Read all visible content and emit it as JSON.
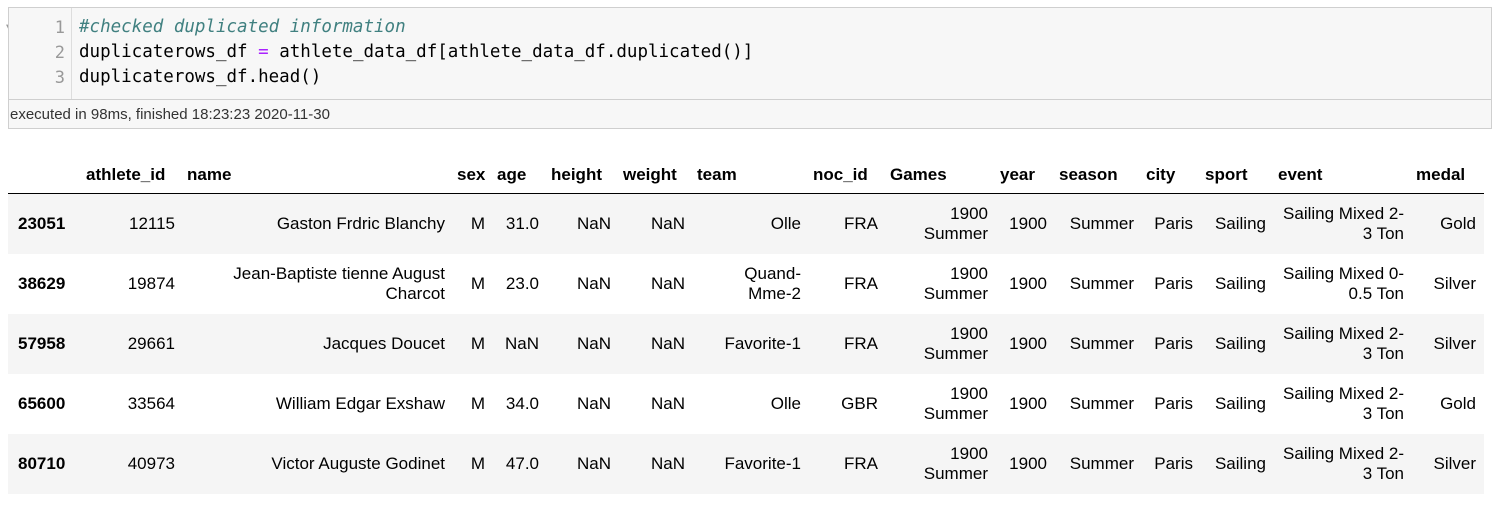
{
  "code_cell": {
    "lines": [
      {
        "number": "1",
        "text": "#checked duplicated information"
      },
      {
        "number": "2",
        "var": "duplicaterows_df",
        "op": "=",
        "expr": "athlete_data_df[athlete_data_df.duplicated()]"
      },
      {
        "number": "3",
        "text": "duplicaterows_df.head()"
      }
    ],
    "status": "executed in 98ms, finished 18:23:23 2020-11-30"
  },
  "table": {
    "columns": [
      "",
      "athlete_id",
      "name",
      "sex",
      "age",
      "height",
      "weight",
      "team",
      "noc_id",
      "Games",
      "year",
      "season",
      "city",
      "sport",
      "event",
      "medal"
    ],
    "rows": [
      {
        "index": "23051",
        "cells": [
          "12115",
          "Gaston Frdric Blanchy",
          "M",
          "31.0",
          "NaN",
          "NaN",
          "Olle",
          "FRA",
          "1900 Summer",
          "1900",
          "Summer",
          "Paris",
          "Sailing",
          "Sailing Mixed 2-3 Ton",
          "Gold"
        ]
      },
      {
        "index": "38629",
        "cells": [
          "19874",
          "Jean-Baptiste tienne August Charcot",
          "M",
          "23.0",
          "NaN",
          "NaN",
          "Quand-Mme-2",
          "FRA",
          "1900 Summer",
          "1900",
          "Summer",
          "Paris",
          "Sailing",
          "Sailing Mixed 0-0.5 Ton",
          "Silver"
        ]
      },
      {
        "index": "57958",
        "cells": [
          "29661",
          "Jacques Doucet",
          "M",
          "NaN",
          "NaN",
          "NaN",
          "Favorite-1",
          "FRA",
          "1900 Summer",
          "1900",
          "Summer",
          "Paris",
          "Sailing",
          "Sailing Mixed 2-3 Ton",
          "Silver"
        ]
      },
      {
        "index": "65600",
        "cells": [
          "33564",
          "William Edgar Exshaw",
          "M",
          "34.0",
          "NaN",
          "NaN",
          "Olle",
          "GBR",
          "1900 Summer",
          "1900",
          "Summer",
          "Paris",
          "Sailing",
          "Sailing Mixed 2-3 Ton",
          "Gold"
        ]
      },
      {
        "index": "80710",
        "cells": [
          "40973",
          "Victor Auguste Godinet",
          "M",
          "47.0",
          "NaN",
          "NaN",
          "Favorite-1",
          "FRA",
          "1900 Summer",
          "1900",
          "Summer",
          "Paris",
          "Sailing",
          "Sailing Mixed 2-3 Ton",
          "Silver"
        ]
      }
    ]
  }
}
